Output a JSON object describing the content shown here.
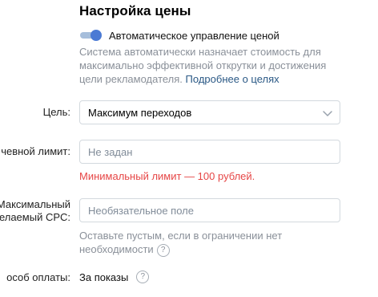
{
  "section": {
    "title": "Настройка цены"
  },
  "auto_price": {
    "label": "Автоматическое управление ценой",
    "enabled": true
  },
  "auto_hint": {
    "text": "Система автоматически назначает стоимость для максимально эффективной открутки и достижения цели рекламодателя. ",
    "link": "Подробнее о целях"
  },
  "goal": {
    "label": "Цель:",
    "value": "Максимум переходов"
  },
  "daily_limit": {
    "label": "чевной лимит:",
    "placeholder": "Не задан",
    "error": "Минимальный лимит — 100 рублей."
  },
  "max_cpc": {
    "label_line1": "Максимальный",
    "label_line2": "целаемый CPC:",
    "placeholder": "Необязательное поле",
    "hint_line1": "Оставьте пустым, если в ограничении нет",
    "hint_line2": "необходимости"
  },
  "payment": {
    "label": "особ оплаты:",
    "value": "За показы"
  },
  "help_glyph": "?",
  "colors": {
    "accent": "#4b7ad4",
    "link": "#2a5885",
    "error": "#e64646",
    "hint": "#8a9099",
    "border": "#d3d9de"
  }
}
